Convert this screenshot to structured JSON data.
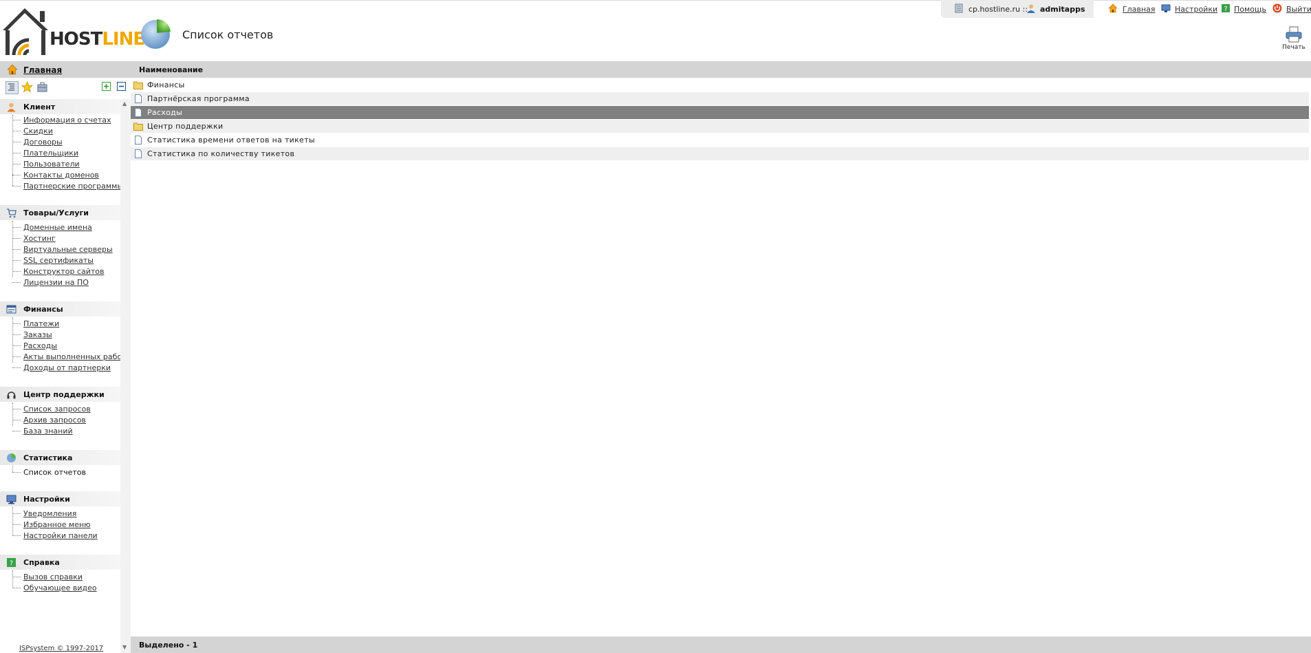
{
  "header": {
    "logo_text_a": "HOST",
    "logo_text_b": "LINE",
    "page_title": "Список отчетов",
    "host": "cp.hostline.ru ::",
    "user": "admitapps",
    "links": {
      "home": "Главная",
      "settings": "Настройки",
      "help": "Помощь",
      "logout": "Выйти"
    },
    "print_label": "Печать"
  },
  "sidebar": {
    "home_label": "Главная",
    "sections": [
      {
        "title": "Клиент",
        "icon": "client-icon",
        "items": [
          "Информация о счетах",
          "Скидки",
          "Договоры",
          "Плательщики",
          "Пользователи",
          "Контакты доменов",
          "Партнерские программы"
        ]
      },
      {
        "title": "Товары/Услуги",
        "icon": "cart-icon",
        "items": [
          "Доменные имена",
          "Хостинг",
          "Виртуальные серверы",
          "SSL сертификаты",
          "Конструктор сайтов",
          "Лицензии на ПО"
        ]
      },
      {
        "title": "Финансы",
        "icon": "finance-icon",
        "items": [
          "Платежи",
          "Заказы",
          "Расходы",
          "Акты выполненных работ",
          "Доходы от партнерки"
        ]
      },
      {
        "title": "Центр поддержки",
        "icon": "headset-icon",
        "items": [
          "Список запросов",
          "Архив запросов",
          "База знаний"
        ]
      },
      {
        "title": "Статистика",
        "icon": "pie-chart-icon",
        "items": [
          "Список отчетов"
        ]
      },
      {
        "title": "Настройки",
        "icon": "monitor-icon",
        "items": [
          "Уведомления",
          "Избранное меню",
          "Настройки панели"
        ]
      },
      {
        "title": "Справка",
        "icon": "help-icon",
        "items": [
          "Вызов справки",
          "Обучающее видео"
        ]
      }
    ],
    "footer": "ISPsystem © 1997-2017"
  },
  "main": {
    "column_header": "Наименование",
    "rows": [
      {
        "label": "Финансы",
        "type": "folder"
      },
      {
        "label": "Партнёрская программа",
        "type": "document"
      },
      {
        "label": "Расходы",
        "type": "document",
        "selected": true
      },
      {
        "label": "Центр поддержки",
        "type": "folder"
      },
      {
        "label": "Статистика времени ответов на тикеты",
        "type": "document"
      },
      {
        "label": "Статистика по количеству тикетов",
        "type": "document"
      }
    ],
    "status": "Выделено - 1"
  }
}
